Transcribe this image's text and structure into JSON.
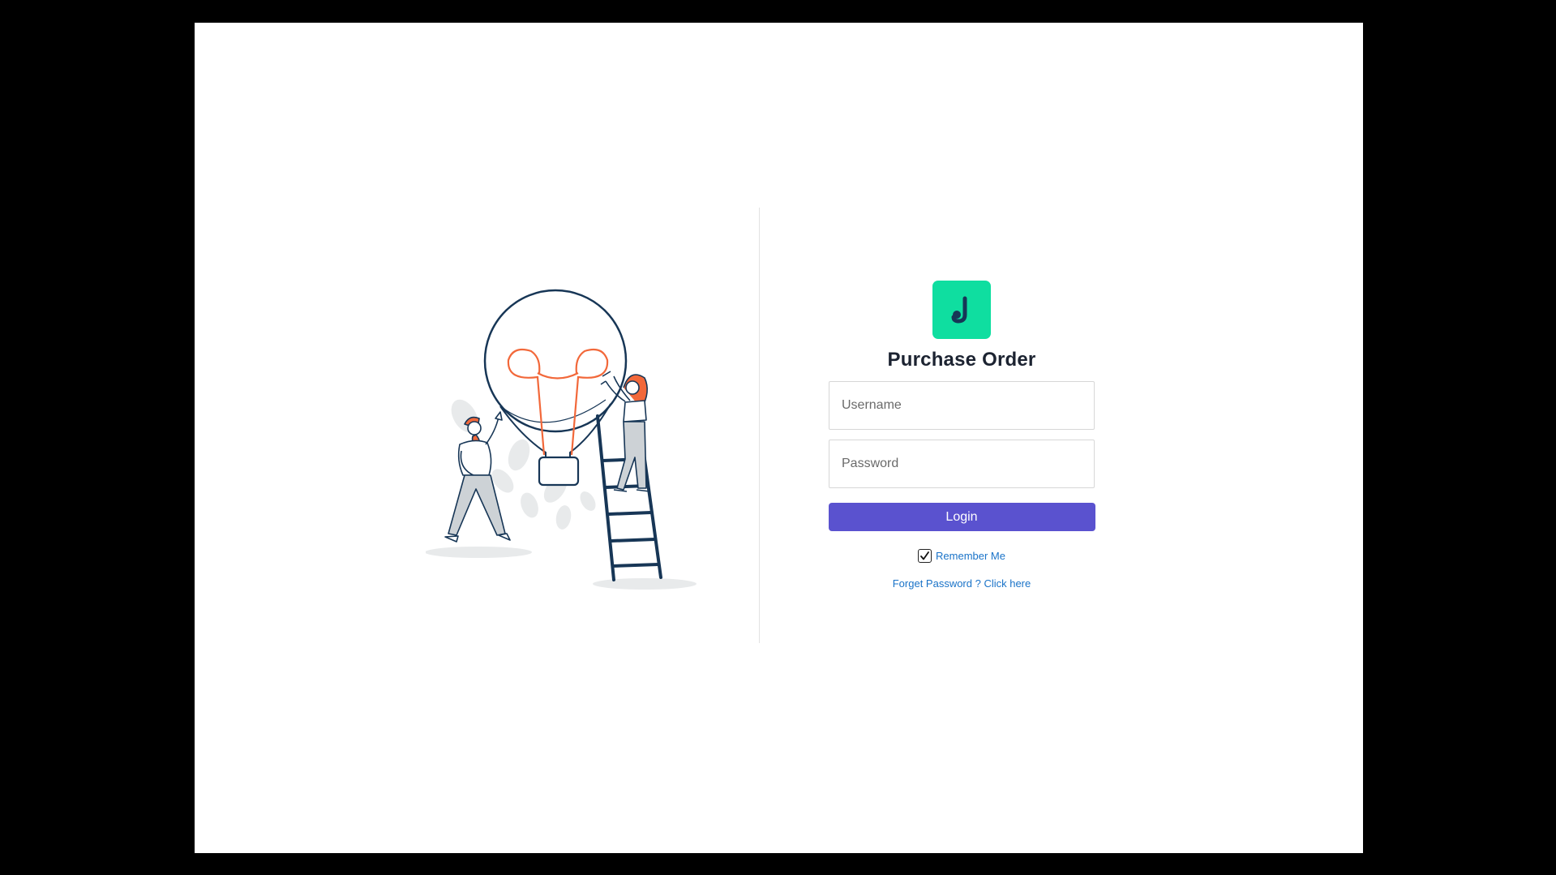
{
  "app": {
    "title": "Purchase Order",
    "logo_icon": "j-logo-icon",
    "logo_color": "#0fdea0"
  },
  "form": {
    "username_placeholder": "Username",
    "username_value": "",
    "password_placeholder": "Password",
    "password_value": "",
    "login_label": "Login",
    "login_color": "#5a52cf",
    "remember_label": "Remember Me",
    "remember_checked": true,
    "forgot_label": "Forget Password ? Click here",
    "link_color": "#1a73c8"
  },
  "illustration": {
    "icon": "lightbulb-teamwork-illustration"
  }
}
